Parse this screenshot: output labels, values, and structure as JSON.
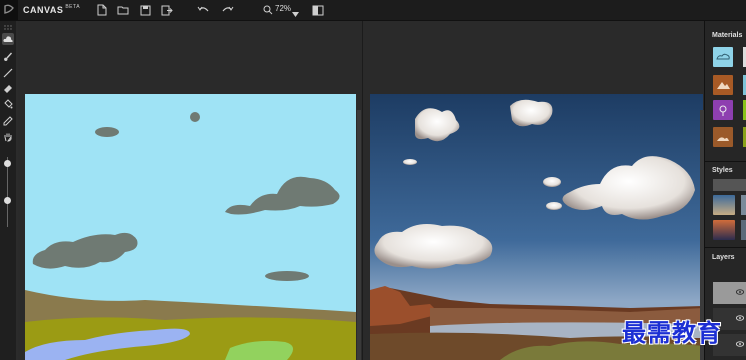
{
  "app": {
    "title": "CANVAS",
    "badge": "BETA"
  },
  "toolbar": {
    "zoom_label": "72%",
    "icons": [
      "new-file-icon",
      "open-folder-icon",
      "save-icon",
      "export-icon",
      "undo-icon",
      "redo-icon",
      "search-icon",
      "chevron-down-icon",
      "split-view-icon"
    ]
  },
  "tools": [
    "grid-handle-icon",
    "materials-icon",
    "brush-icon",
    "line-icon",
    "eraser-icon",
    "fill-bucket-icon",
    "eyedropper-icon",
    "pan-hand-icon",
    "size-slider"
  ],
  "panel": {
    "materials_title": "Materials",
    "styles_title": "Styles",
    "layers_title": "Layers",
    "material_colors": [
      "#8fd3e8",
      "#a85a25",
      "#8e3fb0",
      "#9b5a2a"
    ],
    "accent": "#9fe3f5"
  },
  "watermark": "最需教育"
}
